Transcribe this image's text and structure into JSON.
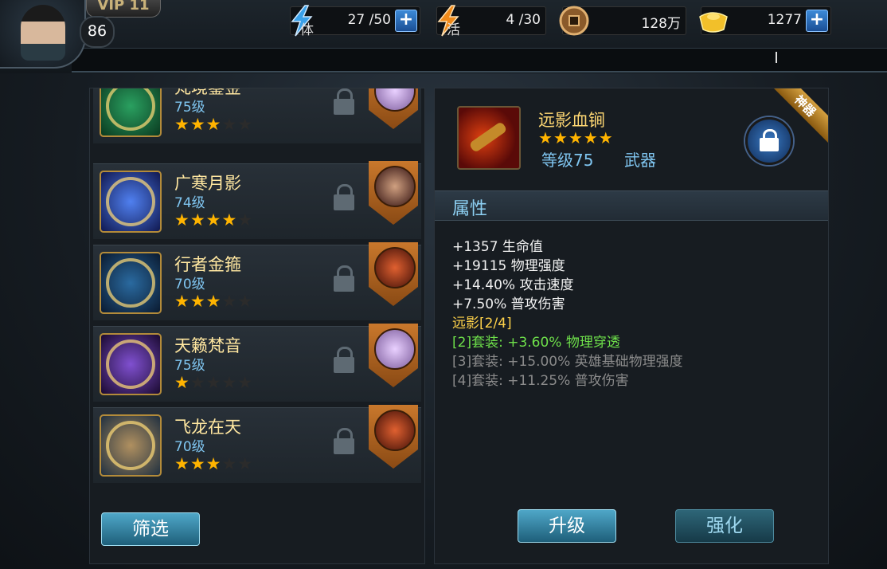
{
  "player": {
    "vip": "VIP 11",
    "level": "86"
  },
  "resources": {
    "stamina": {
      "label": "体",
      "value": "27 /50",
      "plus": "+"
    },
    "vitality": {
      "label": "活",
      "value": "4 /30",
      "plus": ""
    },
    "coins": {
      "value": "128万"
    },
    "ingots": {
      "value": "1277",
      "plus": "+"
    }
  },
  "list": {
    "items": [
      {
        "name": "梵境鎏金",
        "level": "75级",
        "stars": "★★★",
        "stars_off": "★★"
      },
      {
        "name": "广寒月影",
        "level": "74级",
        "stars": "★★★★",
        "stars_off": "★"
      },
      {
        "name": "行者金箍",
        "level": "70级",
        "stars": "★★★",
        "stars_off": "★★"
      },
      {
        "name": "天籁梵音",
        "level": "75级",
        "stars": "★",
        "stars_off": "★★★★"
      },
      {
        "name": "飞龙在天",
        "level": "70级",
        "stars": "★★★",
        "stars_off": "★★"
      }
    ],
    "filter_label": "筛选"
  },
  "detail": {
    "badge": "神器",
    "name": "远影血锏",
    "stars": "★★★★★",
    "level": "等级75",
    "type": "武器",
    "attr_title": "属性",
    "stats": [
      "+1357 生命值",
      "+19115 物理强度",
      "+14.40% 攻击速度",
      "+7.50% 普攻伤害"
    ],
    "set_title": "远影[2/4]",
    "set_bonus_active": "[2]套装: +3.60% 物理穿透",
    "set_bonus_inactive": [
      "[3]套装: +15.00% 英雄基础物理强度",
      "[4]套装: +11.25% 普攻伤害"
    ],
    "upgrade_label": "升级",
    "enhance_label": "强化"
  },
  "colors": {
    "accent_blue": "#4fa7c8",
    "gold": "#ffb400",
    "set_green": "#6ee04a"
  }
}
